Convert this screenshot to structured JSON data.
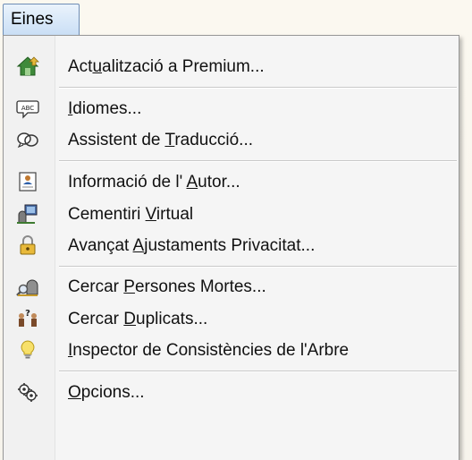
{
  "menubar": {
    "menu_label": "Eines"
  },
  "menu": {
    "items": [
      {
        "label": "Actualització a Premium...",
        "icon": "house-upgrade-icon"
      },
      {
        "label": "Idiomes...",
        "icon": "abc-speech-bubble-icon"
      },
      {
        "label": "Assistent de Traducció...",
        "icon": "translation-bubbles-icon"
      },
      {
        "label": "Informació de l'Autor...",
        "icon": "author-card-icon"
      },
      {
        "label": "Cementiri Virtual",
        "icon": "virtual-cemetery-icon"
      },
      {
        "label": "Avançat Ajustaments Privacitat...",
        "icon": "padlock-icon"
      },
      {
        "label": "Cercar Persones Mortes...",
        "icon": "search-gravestone-icon"
      },
      {
        "label": "Cercar Duplicats...",
        "icon": "duplicate-persons-icon"
      },
      {
        "label": "Inspector de Consistències de l'Arbre",
        "icon": "lightbulb-icon"
      },
      {
        "label": "Opcions...",
        "icon": "gears-icon"
      }
    ]
  },
  "colors": {
    "menubar_highlight": "#c9def5",
    "menu_background": "#f5f5f5",
    "separator": "#c9c9c9"
  }
}
